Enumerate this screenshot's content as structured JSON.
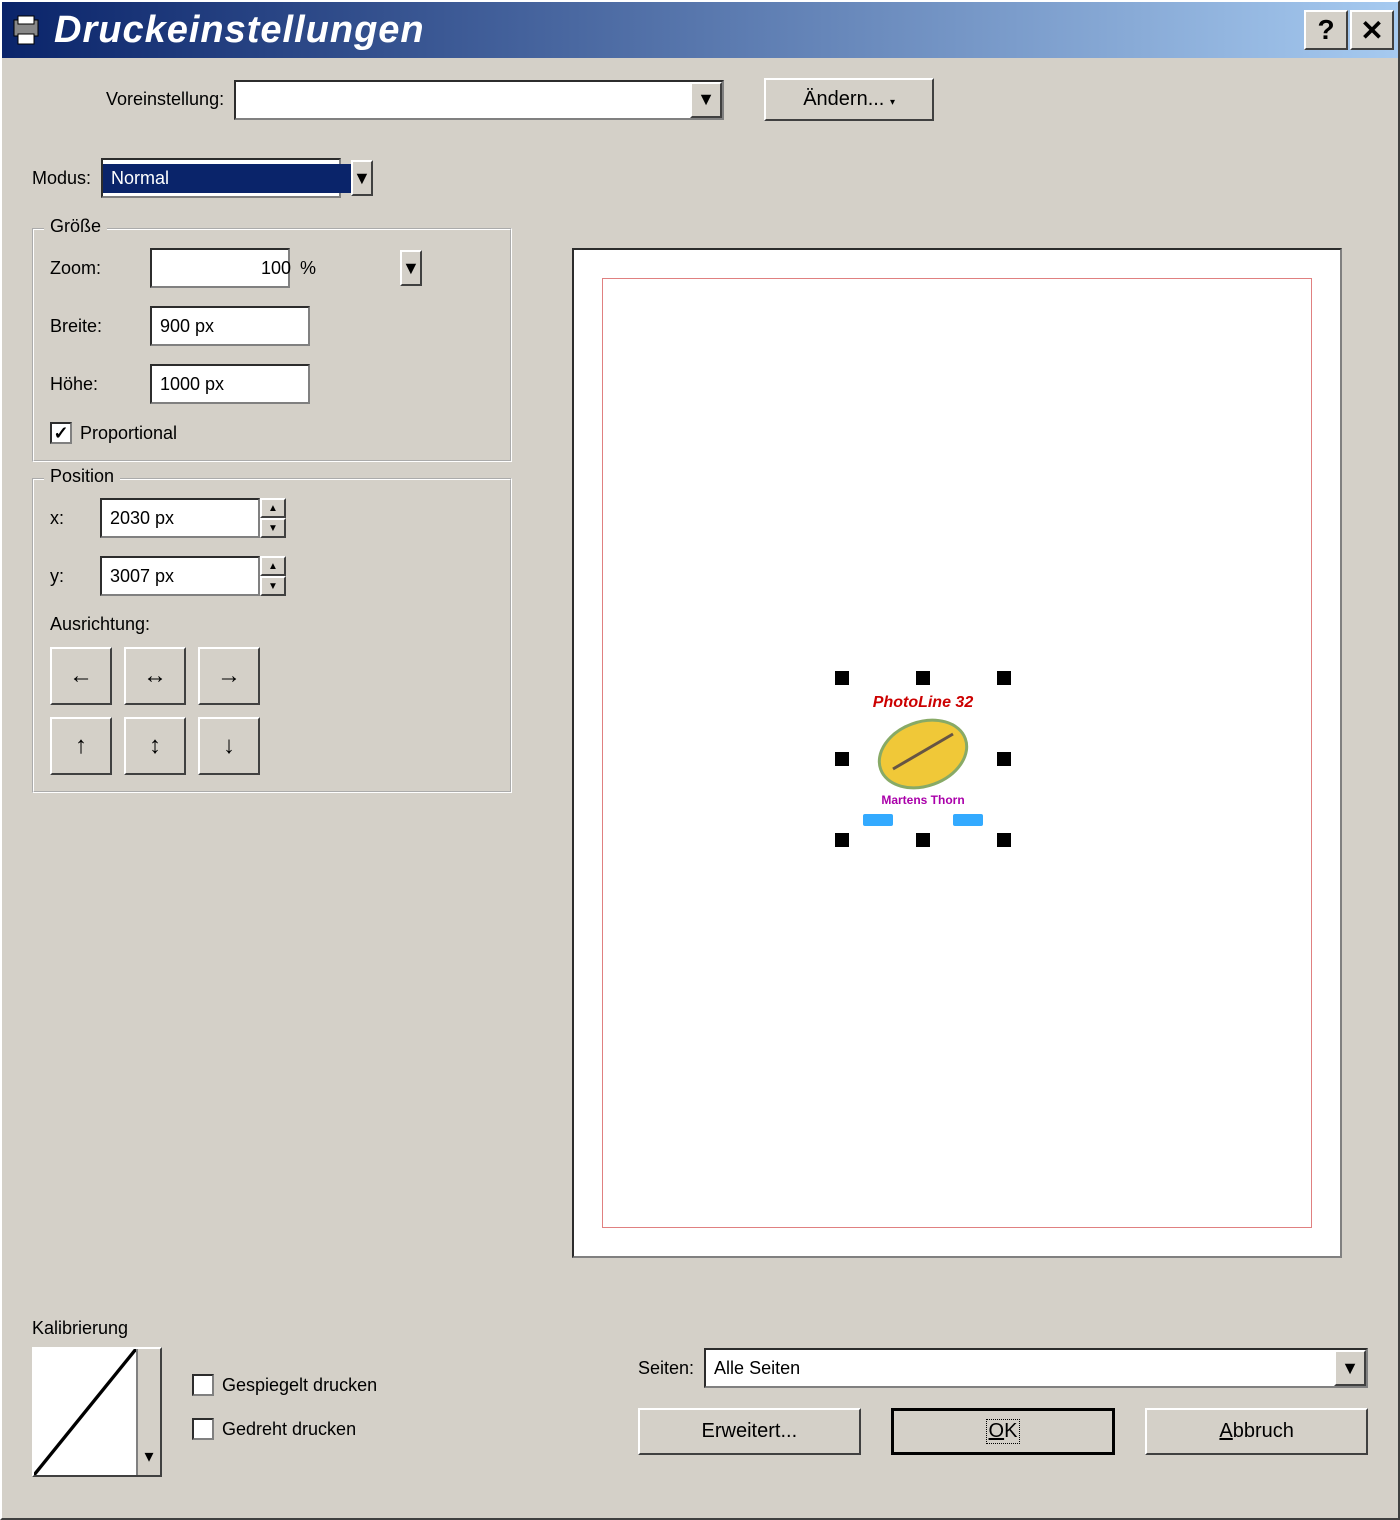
{
  "window": {
    "title": "Druckeinstellungen"
  },
  "preset": {
    "label": "Voreinstellung:",
    "value": "",
    "change_button": "Ändern..."
  },
  "mode": {
    "label": "Modus:",
    "value": "Normal"
  },
  "size": {
    "legend": "Größe",
    "zoom_label": "Zoom:",
    "zoom_value": "100",
    "zoom_unit": "%",
    "width_label": "Breite:",
    "width_value": "900 px",
    "height_label": "Höhe:",
    "height_value": "1000 px",
    "proportional_label": "Proportional",
    "proportional_checked": true
  },
  "position": {
    "legend": "Position",
    "x_label": "x:",
    "x_value": "2030 px",
    "y_label": "y:",
    "y_value": "3007 px",
    "alignment_label": "Ausrichtung:"
  },
  "calibration": {
    "label": "Kalibrierung"
  },
  "mirror": {
    "label": "Gespiegelt drucken",
    "checked": false
  },
  "rotate": {
    "label": "Gedreht drucken",
    "checked": false
  },
  "pages": {
    "label": "Seiten:",
    "value": "Alle Seiten"
  },
  "buttons": {
    "advanced": "Erweitert...",
    "ok": "OK",
    "cancel": "Abbruch"
  }
}
